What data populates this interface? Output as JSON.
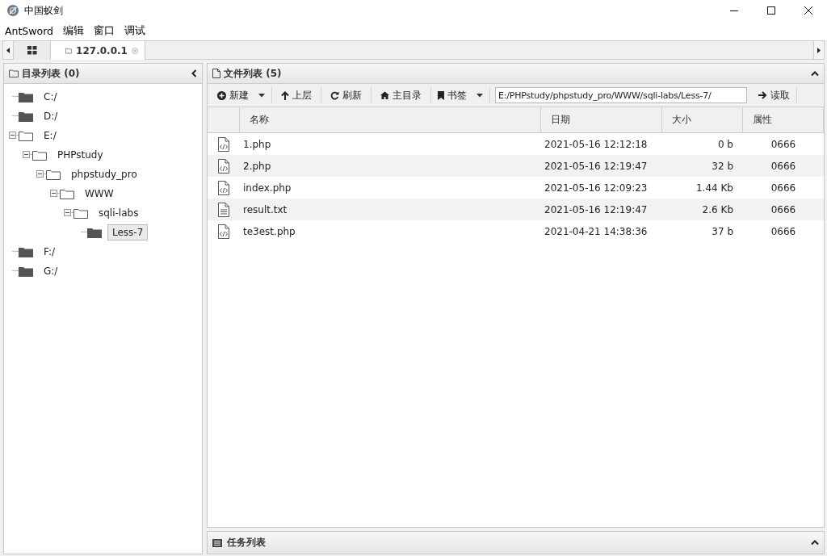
{
  "window": {
    "title": "中国蚁剑"
  },
  "menu": [
    "AntSword",
    "编辑",
    "窗口",
    "调试"
  ],
  "tabs": [
    {
      "kind": "home",
      "selected": false
    },
    {
      "kind": "host",
      "label": "127.0.0.1",
      "selected": true
    }
  ],
  "dir_panel": {
    "title": "目录列表 (0)",
    "tree": [
      {
        "label": "C:/",
        "expanded": false,
        "selected": false
      },
      {
        "label": "D:/",
        "expanded": false,
        "selected": false
      },
      {
        "label": "E:/",
        "expanded": true,
        "selected": false,
        "children": [
          {
            "label": "PHPstudy",
            "expanded": true,
            "selected": false,
            "children": [
              {
                "label": "phpstudy_pro",
                "expanded": true,
                "selected": false,
                "children": [
                  {
                    "label": "WWW",
                    "expanded": true,
                    "selected": false,
                    "children": [
                      {
                        "label": "sqli-labs",
                        "expanded": true,
                        "selected": false,
                        "children": [
                          {
                            "label": "Less-7",
                            "expanded": false,
                            "selected": true
                          }
                        ]
                      }
                    ]
                  }
                ]
              }
            ]
          }
        ]
      },
      {
        "label": "F:/",
        "expanded": false,
        "selected": false
      },
      {
        "label": "G:/",
        "expanded": false,
        "selected": false
      }
    ]
  },
  "file_panel": {
    "title": "文件列表 (5)",
    "toolbar": [
      {
        "kind": "new",
        "label": "新建",
        "dropdown": true
      },
      {
        "kind": "up",
        "label": "上层",
        "dropdown": false
      },
      {
        "kind": "refresh",
        "label": "刷新",
        "dropdown": false
      },
      {
        "kind": "home",
        "label": "主目录",
        "dropdown": false
      },
      {
        "kind": "bookmark",
        "label": "书签",
        "dropdown": true
      }
    ],
    "path": "E:/PHPstudy/phpstudy_pro/WWW/sqli-labs/Less-7/",
    "read_button": "读取",
    "columns": [
      "名称",
      "日期",
      "大小",
      "属性"
    ],
    "rows": [
      {
        "kind": "php",
        "name": "1.php",
        "date": "2021-05-16 12:12:18",
        "size": "0 b",
        "attr": "0666"
      },
      {
        "kind": "php",
        "name": "2.php",
        "date": "2021-05-16 12:19:47",
        "size": "32 b",
        "attr": "0666"
      },
      {
        "kind": "php",
        "name": "index.php",
        "date": "2021-05-16 12:09:23",
        "size": "1.44 Kb",
        "attr": "0666"
      },
      {
        "kind": "txt",
        "name": "result.txt",
        "date": "2021-05-16 12:19:47",
        "size": "2.6 Kb",
        "attr": "0666"
      },
      {
        "kind": "php",
        "name": "te3est.php",
        "date": "2021-04-21 14:38:36",
        "size": "37 b",
        "attr": "0666"
      }
    ]
  },
  "task_panel": {
    "title": "任务列表"
  }
}
